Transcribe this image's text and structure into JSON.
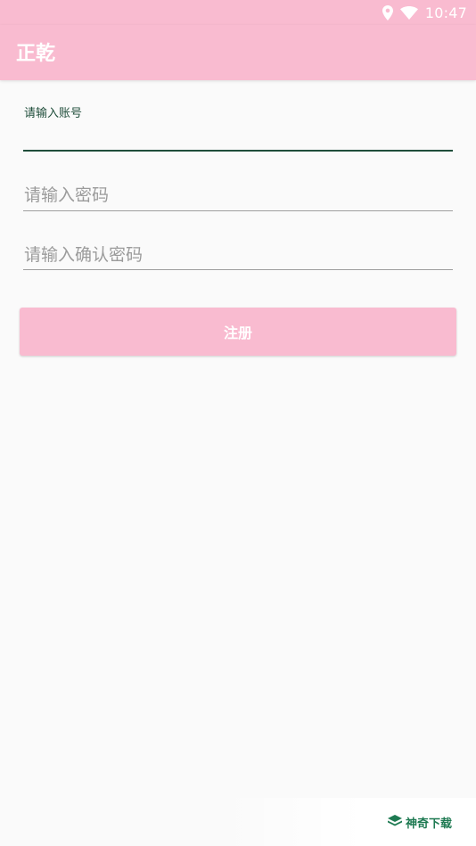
{
  "status_bar": {
    "time": "10:47",
    "icons": [
      "location-icon",
      "wifi-icon"
    ]
  },
  "app_bar": {
    "title": "正乾"
  },
  "form": {
    "account": {
      "floating_label": "请输入账号",
      "value": ""
    },
    "password": {
      "placeholder": "请输入密码",
      "value": ""
    },
    "confirm_password": {
      "placeholder": "请输入确认密码",
      "value": ""
    },
    "register_label": "注册"
  },
  "watermark": {
    "text": "神奇下载"
  },
  "colors": {
    "primary": "#f9bbd0",
    "accent": "#1f4d3a",
    "background": "#fafafa",
    "watermark": "#1e7a52"
  }
}
